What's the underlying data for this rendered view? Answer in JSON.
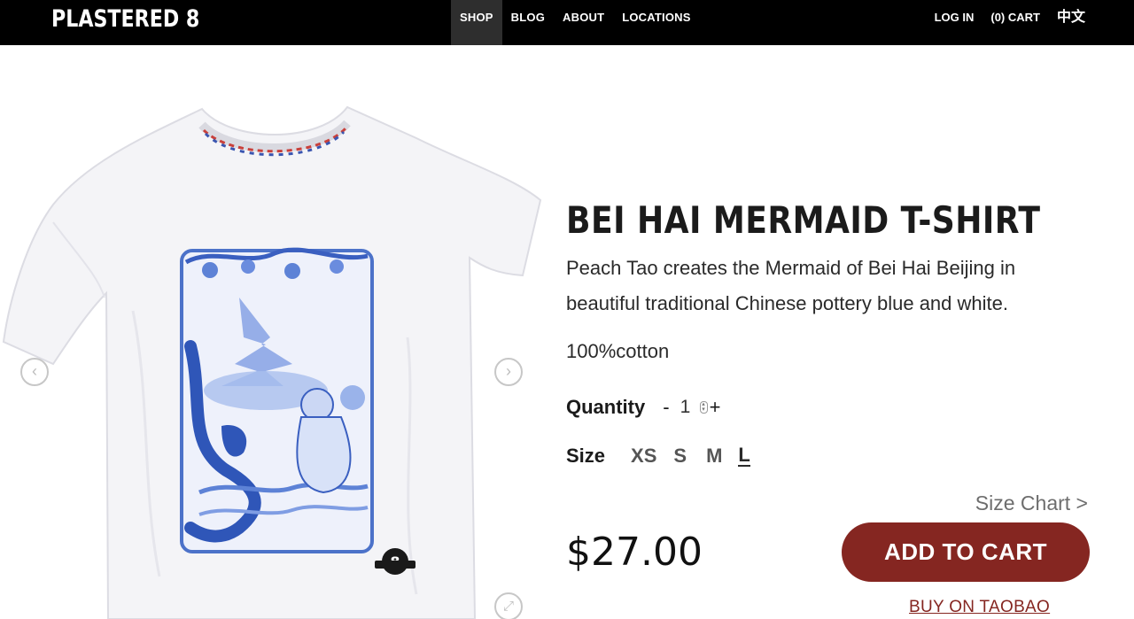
{
  "header": {
    "logo": "PLASTERED 8",
    "nav": [
      {
        "label": "SHOP",
        "active": true
      },
      {
        "label": "BLOG",
        "active": false
      },
      {
        "label": "ABOUT",
        "active": false
      },
      {
        "label": "LOCATIONS",
        "active": false
      }
    ],
    "login": "LOG IN",
    "cart": "(0) CART",
    "language": "中文"
  },
  "gallery": {
    "prev_icon": "chevron-left-icon",
    "next_icon": "chevron-right-icon",
    "zoom_icon": "expand-icon"
  },
  "product": {
    "title": "BEI HAI MERMAID T-SHIRT",
    "description": "Peach Tao creates the Mermaid of Bei Hai Beijing in beautiful traditional Chinese pottery blue and white.",
    "material": "100%cotton",
    "quantity_label": "Quantity",
    "quantity_minus": "-",
    "quantity_value": "1",
    "quantity_plus": "+",
    "size_label": "Size",
    "sizes": [
      "XS",
      "S",
      "M",
      "L"
    ],
    "selected_size": "L",
    "size_chart": "Size Chart >",
    "price": "$27.00",
    "add_to_cart": "ADD TO CART",
    "buy_taobao": "BUY ON TAOBAO"
  },
  "colors": {
    "header_bg": "#000000",
    "accent": "#852621"
  }
}
